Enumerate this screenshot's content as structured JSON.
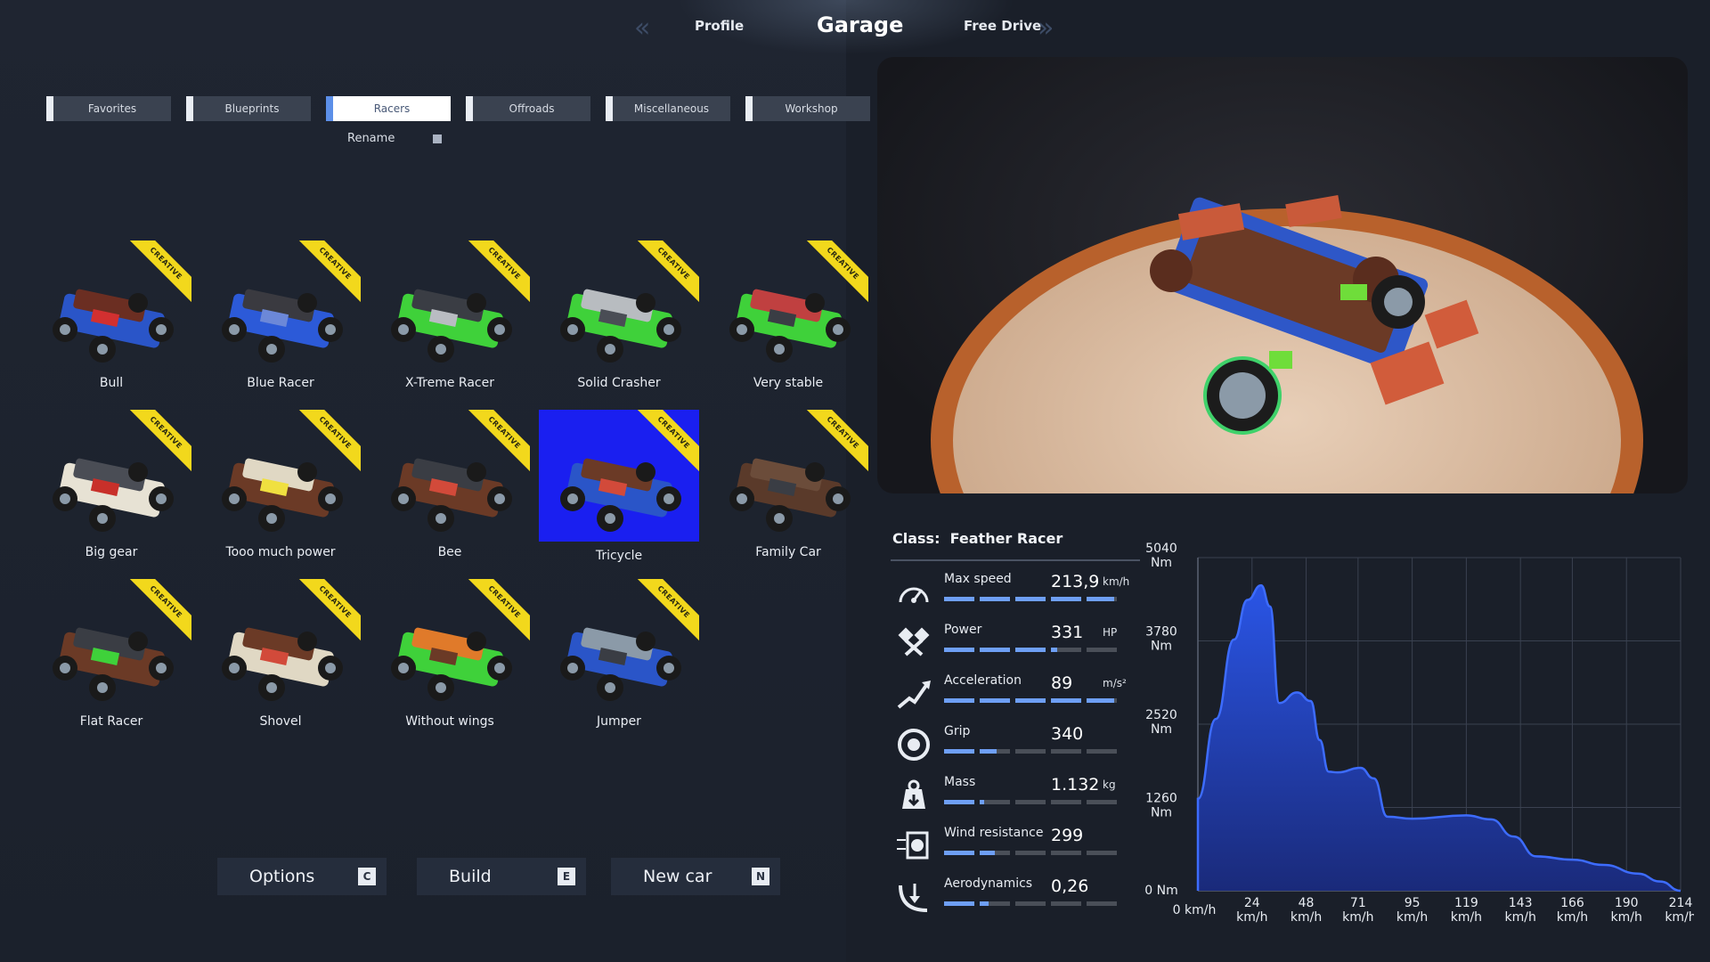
{
  "nav": {
    "left": "Profile",
    "center": "Garage",
    "right": "Free Drive"
  },
  "tabs": [
    {
      "label": "Favorites",
      "active": false
    },
    {
      "label": "Blueprints",
      "active": false
    },
    {
      "label": "Racers",
      "active": true
    },
    {
      "label": "Offroads",
      "active": false
    },
    {
      "label": "Miscellaneous",
      "active": false
    },
    {
      "label": "Workshop",
      "active": false
    }
  ],
  "rename_label": "Rename",
  "ribbon_text": "CREATIVE",
  "cars": [
    {
      "name": "Bull"
    },
    {
      "name": "Blue Racer"
    },
    {
      "name": "X-Treme Racer"
    },
    {
      "name": "Solid Crasher"
    },
    {
      "name": "Very stable"
    },
    {
      "name": "Big gear"
    },
    {
      "name": "Tooo much power"
    },
    {
      "name": "Bee"
    },
    {
      "name": "Tricycle",
      "selected": true
    },
    {
      "name": "Family Car"
    },
    {
      "name": "Flat Racer"
    },
    {
      "name": "Shovel"
    },
    {
      "name": "Without wings"
    },
    {
      "name": "Jumper"
    }
  ],
  "buttons": [
    {
      "label": "Options",
      "key": "C"
    },
    {
      "label": "Build",
      "key": "E"
    },
    {
      "label": "New car",
      "key": "N"
    }
  ],
  "class": {
    "prefix": "Class:",
    "name": "Feather Racer"
  },
  "stats": [
    {
      "name": "Max speed",
      "value": "213,9",
      "unit": "km/h",
      "fill": 0.98,
      "icon": "speedometer-icon"
    },
    {
      "name": "Power",
      "value": "331",
      "unit": "HP",
      "fill": 0.64,
      "icon": "pistons-icon"
    },
    {
      "name": "Acceleration",
      "value": "89",
      "unit": "m/s²",
      "fill": 0.98,
      "icon": "acceleration-icon"
    },
    {
      "name": "Grip",
      "value": "340",
      "unit": "",
      "fill": 0.31,
      "icon": "tire-icon"
    },
    {
      "name": "Mass",
      "value": "1.132",
      "unit": "kg",
      "fill": 0.23,
      "icon": "weight-icon"
    },
    {
      "name": "Wind resistance",
      "value": "299",
      "unit": "",
      "fill": 0.3,
      "icon": "wind-icon"
    },
    {
      "name": "Aerodynamics",
      "value": "0,26",
      "unit": "",
      "fill": 0.26,
      "icon": "aerodynamics-icon"
    }
  ],
  "colors": {
    "accent": "#5c8fe8",
    "selected_bg": "#1a1ff0",
    "ribbon": "#f2d81c",
    "chart_fill": "#1f44c8"
  },
  "chart_data": {
    "type": "area",
    "y_ticks": [
      "5040\nNm",
      "3780\nNm",
      "2520\nNm",
      "1260\nNm",
      "0 Nm"
    ],
    "y_values": [
      5040,
      3780,
      2520,
      1260,
      0
    ],
    "x_ticks": [
      "0 km/h",
      "24\nkm/h",
      "48\nkm/h",
      "71\nkm/h",
      "95\nkm/h",
      "119\nkm/h",
      "143\nkm/h",
      "166\nkm/h",
      "190\nkm/h",
      "214\nkm/h"
    ],
    "x_values": [
      0,
      24,
      48,
      71,
      95,
      119,
      143,
      166,
      190,
      214
    ],
    "xlim": [
      0,
      214
    ],
    "ylim": [
      0,
      5040
    ],
    "grid": true,
    "series": [
      {
        "values": [
          [
            0,
            1390
          ],
          [
            8,
            2600
          ],
          [
            16,
            3800
          ],
          [
            22,
            4400
          ],
          [
            28,
            4620
          ],
          [
            32,
            4300
          ],
          [
            36,
            2840
          ],
          [
            44,
            3000
          ],
          [
            50,
            2870
          ],
          [
            54,
            2280
          ],
          [
            58,
            1800
          ],
          [
            62,
            1790
          ],
          [
            72,
            1860
          ],
          [
            78,
            1700
          ],
          [
            84,
            1120
          ],
          [
            95,
            1090
          ],
          [
            119,
            1140
          ],
          [
            130,
            1080
          ],
          [
            140,
            820
          ],
          [
            150,
            520
          ],
          [
            166,
            470
          ],
          [
            180,
            390
          ],
          [
            195,
            260
          ],
          [
            205,
            140
          ],
          [
            214,
            0
          ]
        ]
      }
    ]
  }
}
